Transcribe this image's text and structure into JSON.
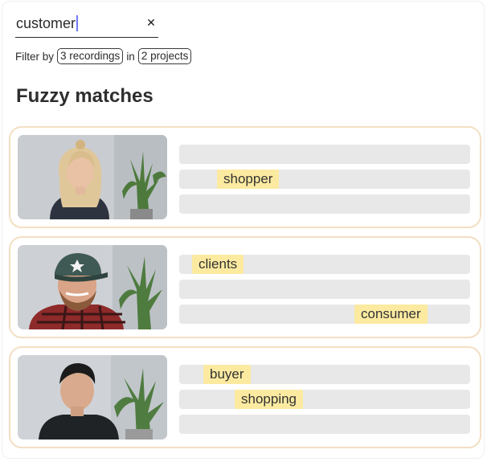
{
  "search": {
    "value": "customer"
  },
  "filter": {
    "prefix": "Filter by",
    "recordings_chip": "3 recordings",
    "middle": "in",
    "projects_chip": "2 projects"
  },
  "section_title": "Fuzzy matches",
  "results": [
    {
      "thumbnail": "woman-blonde-speaker",
      "rows": [
        {
          "highlight": ""
        },
        {
          "highlight": "shopper"
        },
        {
          "highlight": ""
        }
      ]
    },
    {
      "thumbnail": "man-cap-plaid-speaker",
      "rows": [
        {
          "highlight": "clients"
        },
        {
          "highlight": ""
        },
        {
          "highlight": "consumer"
        }
      ]
    },
    {
      "thumbnail": "man-dark-shirt-speaker",
      "rows": [
        {
          "highlight": "buyer"
        },
        {
          "highlight": "shopping"
        },
        {
          "highlight": ""
        }
      ]
    }
  ],
  "colors": {
    "highlight": "#fbeaa0",
    "card_border": "#f3dfc3",
    "bar": "#e8e8e8",
    "caret": "#6f78ff"
  }
}
